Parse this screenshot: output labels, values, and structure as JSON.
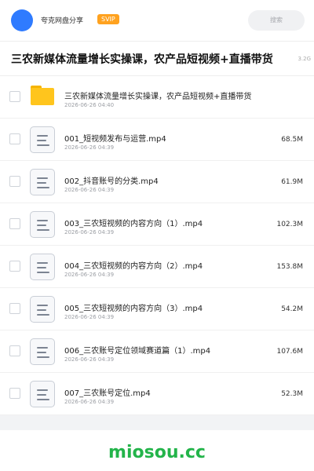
{
  "header": {
    "app_name": "夸克网盘分享",
    "badge": "SVIP",
    "search_placeholder": "搜索"
  },
  "title_bar": {
    "title": "三农新媒体流量增长实操课，农产品短视频+直播带货",
    "total_size": "3.2G"
  },
  "files": [
    {
      "type": "folder",
      "name": "三农新媒体流量增长实操课，农产品短视频+直播带货",
      "date": "2026-06-26 04:40",
      "size": ""
    },
    {
      "type": "video",
      "name": "001_短视频发布与运营.mp4",
      "date": "2026-06-26 04:39",
      "size": "68.5M"
    },
    {
      "type": "video",
      "name": "002_抖音账号的分类.mp4",
      "date": "2026-06-26 04:39",
      "size": "61.9M"
    },
    {
      "type": "video",
      "name": "003_三农短视频的内容方向（1）.mp4",
      "date": "2026-06-26 04:39",
      "size": "102.3M"
    },
    {
      "type": "video",
      "name": "004_三农短视频的内容方向（2）.mp4",
      "date": "2026-06-26 04:39",
      "size": "153.8M"
    },
    {
      "type": "video",
      "name": "005_三农短视频的内容方向（3）.mp4",
      "date": "2026-06-26 04:39",
      "size": "54.2M"
    },
    {
      "type": "video",
      "name": "006_三农账号定位领域赛道篇（1）.mp4",
      "date": "2026-06-26 04:39",
      "size": "107.6M"
    },
    {
      "type": "video",
      "name": "007_三农账号定位.mp4",
      "date": "2026-06-26 04:39",
      "size": "52.3M"
    }
  ],
  "watermark": "miosou.cc",
  "colors": {
    "avatar": "#2f7bff",
    "badge": "#ffa21f",
    "folder": "#ffc51d",
    "watermark": "#23b44a"
  }
}
